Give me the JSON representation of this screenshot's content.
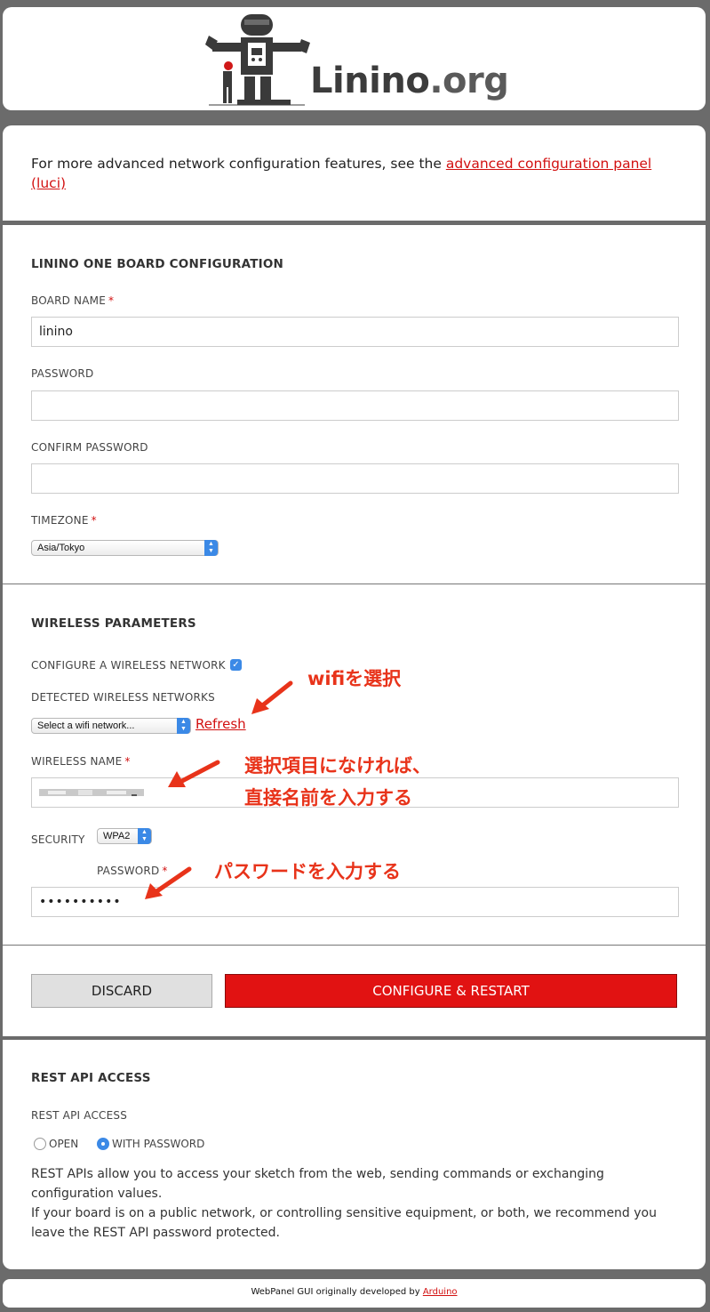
{
  "header": {
    "logo_main": "Linino",
    "logo_suffix": ".org"
  },
  "info": {
    "text": "For more advanced network configuration features, see the ",
    "link": "advanced configuration panel (luci)"
  },
  "board": {
    "title": "LININO ONE BOARD CONFIGURATION",
    "board_name_label": "BOARD NAME",
    "board_name_value": "linino",
    "password_label": "PASSWORD",
    "confirm_password_label": "CONFIRM PASSWORD",
    "timezone_label": "TIMEZONE",
    "timezone_value": "Asia/Tokyo",
    "required_mark": "*"
  },
  "wireless": {
    "title": "WIRELESS PARAMETERS",
    "configure_label": "CONFIGURE A WIRELESS NETWORK",
    "configure_checked": true,
    "detected_label": "DETECTED WIRELESS NETWORKS",
    "network_select_value": "Select a wifi network...",
    "refresh_label": "Refresh",
    "name_label": "WIRELESS NAME",
    "security_label": "SECURITY",
    "security_value": "WPA2",
    "password_label": "PASSWORD",
    "password_value": "••••••••••"
  },
  "actions": {
    "discard_label": "DISCARD",
    "configure_label": "CONFIGURE & RESTART"
  },
  "rest": {
    "title": "REST API ACCESS",
    "label": "REST API ACCESS",
    "option_open": "OPEN",
    "option_password": "WITH PASSWORD",
    "selected": "WITH PASSWORD",
    "para1": "REST APIs allow you to access your sketch from the web, sending commands or exchanging configuration values.",
    "para2": "If your board is on a public network, or controlling sensitive equipment, or both, we recommend you leave the REST API password protected."
  },
  "annotations": {
    "select_wifi": "wifiを選択",
    "manual_line1": "選択項目になければ、",
    "manual_line2": "直接名前を入力する",
    "enter_password": "パスワードを入力する"
  },
  "footer": {
    "text": "WebPanel GUI originally developed by ",
    "link": "Arduino"
  },
  "colors": {
    "accent": "#e11212",
    "link": "#d21111",
    "annotation": "#e8331a",
    "checkbox": "#3b89e6"
  }
}
